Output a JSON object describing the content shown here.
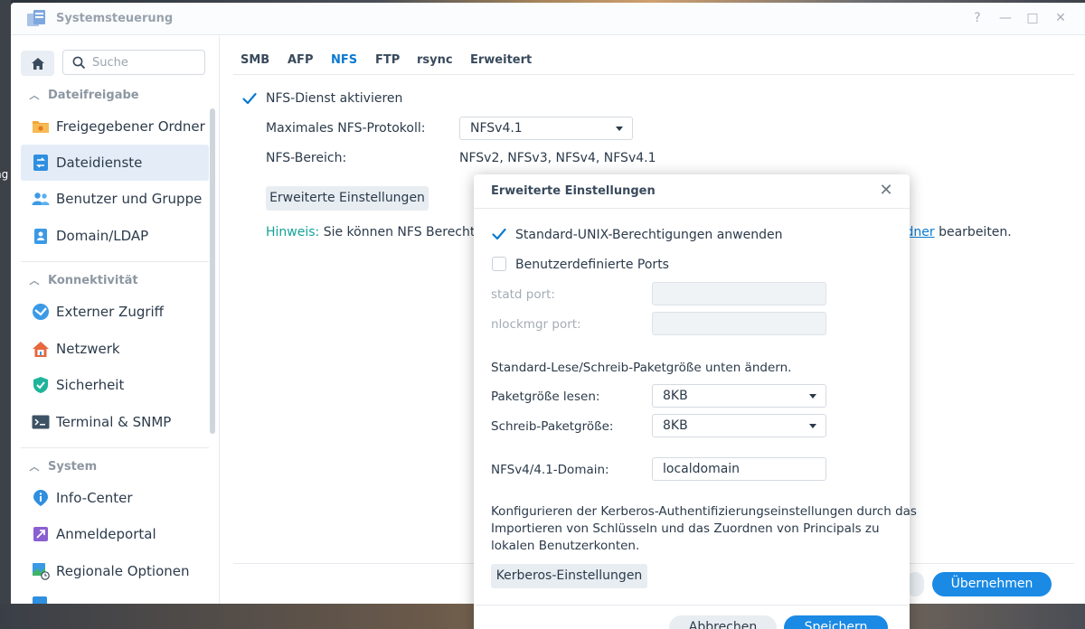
{
  "window": {
    "title": "Systemsteuerung",
    "help": "?",
    "minimize": "—",
    "maximize": "□",
    "close": "✕"
  },
  "desktop": {
    "left_fragment": "ng"
  },
  "sidebar": {
    "search_placeholder": "Suche",
    "sections": {
      "dateifreigabe": "Dateifreigabe",
      "konnektivitaet": "Konnektivität",
      "system": "System"
    },
    "items": {
      "freigegebener_ordner": "Freigegebener Ordner",
      "dateidienste": "Dateidienste",
      "benutzer_gruppe": "Benutzer und Gruppe",
      "domain_ldap": "Domain/LDAP",
      "externer_zugriff": "Externer Zugriff",
      "netzwerk": "Netzwerk",
      "sicherheit": "Sicherheit",
      "terminal_snmp": "Terminal & SNMP",
      "info_center": "Info-Center",
      "anmeldeportal": "Anmeldeportal",
      "regionale_optionen": "Regionale Optionen"
    }
  },
  "tabs": {
    "smb": "SMB",
    "afp": "AFP",
    "nfs": "NFS",
    "ftp": "FTP",
    "rsync": "rsync",
    "erweitert": "Erweitert",
    "active": "NFS"
  },
  "nfs": {
    "enable_label": "NFS-Dienst aktivieren",
    "enable_checked": true,
    "max_protocol_label": "Maximales NFS-Protokoll:",
    "max_protocol_value": "NFSv4.1",
    "range_label": "NFS-Bereich:",
    "range_value": "NFSv2, NFSv3, NFSv4, NFSv4.1",
    "advanced_button": "Erweiterte Einstellungen",
    "hint_key": "Hinweis:",
    "hint_text_start": "Sie können NFS Berechtigu",
    "hint_link": "rdner",
    "hint_text_end": "bearbeiten."
  },
  "footer": {
    "apply_button": "Übernehmen"
  },
  "dialog": {
    "title": "Erweiterte Einstellungen",
    "close": "✕",
    "unix_perm_label": "Standard-UNIX-Berechtigungen anwenden",
    "unix_perm_checked": true,
    "custom_ports_label": "Benutzerdefinierte Ports",
    "custom_ports_checked": false,
    "statd_label": "statd port:",
    "statd_value": "",
    "nlockmgr_label": "nlockmgr port:",
    "nlockmgr_value": "",
    "packet_size_heading": "Standard-Lese/Schreib-Paketgröße unten ändern.",
    "read_size_label": "Paketgröße lesen:",
    "read_size_value": "8KB",
    "write_size_label": "Schreib-Paketgröße:",
    "write_size_value": "8KB",
    "domain_label": "NFSv4/4.1-Domain:",
    "domain_value": "localdomain",
    "kerberos_text_1": "Konfigurieren der Kerberos-Authentifizierungseinstellungen durch das",
    "kerberos_text_2": "Importieren von Schlüsseln und das Zuordnen von Principals zu",
    "kerberos_text_3": "lokalen Benutzerkonten.",
    "kerberos_button": "Kerberos-Einstellungen",
    "cancel_button": "Abbrechen",
    "save_button": "Speichern"
  },
  "colors": {
    "accent": "#1a8ae5",
    "hint": "#13a39a",
    "active_bg": "#e4edf7"
  }
}
